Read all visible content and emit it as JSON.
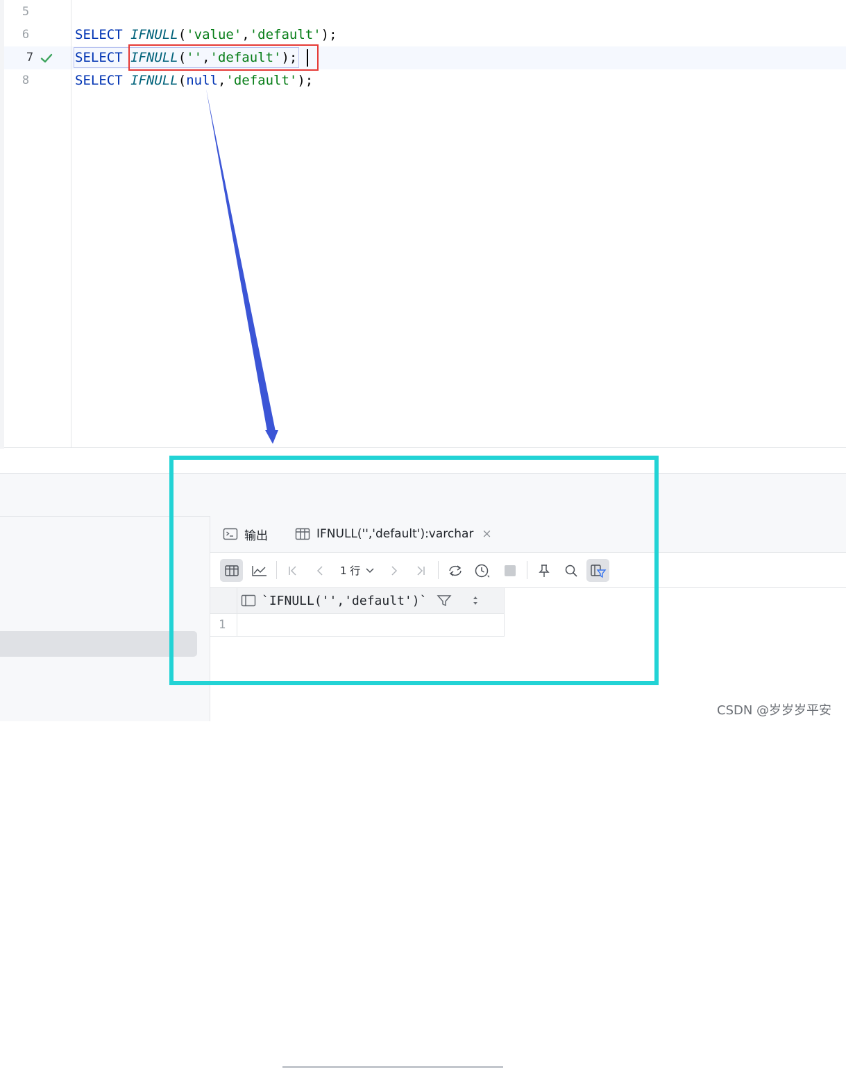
{
  "editor": {
    "lines": [
      {
        "num": "5"
      },
      {
        "num": "6",
        "kw": "SELECT",
        "fn": "IFNULL",
        "open": "(",
        "a1": "'value'",
        "comma": ",",
        "a2": "'default'",
        "close": ");"
      },
      {
        "num": "7",
        "kw": "SELECT",
        "fn": "IFNULL",
        "open": "(",
        "a1": "''",
        "comma": ",",
        "a2": "'default'",
        "close": ");",
        "status": "check-icon"
      },
      {
        "num": "8",
        "kw": "SELECT",
        "fn": "IFNULL",
        "open": "(",
        "a1": "null",
        "comma": ",",
        "a2": "'default'",
        "close": ");"
      }
    ]
  },
  "results": {
    "tabs": [
      {
        "label": "输出",
        "icon": "console-icon"
      },
      {
        "label": "IFNULL('','default'):varchar",
        "icon": "table-icon",
        "close": "×"
      }
    ],
    "toolbar": {
      "rows_label": "1 行",
      "buttons": [
        "table-view-icon",
        "chart-view-icon",
        "first-page-icon",
        "prev-page-icon",
        "next-page-icon",
        "last-page-icon",
        "refresh-icon",
        "history-icon",
        "stop-icon",
        "pin-icon",
        "search-icon",
        "filter-view-icon"
      ]
    },
    "grid": {
      "columns": [
        "`IFNULL('','default')`"
      ],
      "rows": [
        {
          "num": "1",
          "value": ""
        }
      ]
    }
  },
  "watermark": "CSDN @岁岁岁平安",
  "colors": {
    "keyword": "#0033b3",
    "function": "#00627a",
    "string": "#067d17",
    "annotation_red": "#e53935",
    "annotation_cyan": "#22d3d5",
    "annotation_arrow": "#3b55d6",
    "check": "#3aa35b"
  }
}
